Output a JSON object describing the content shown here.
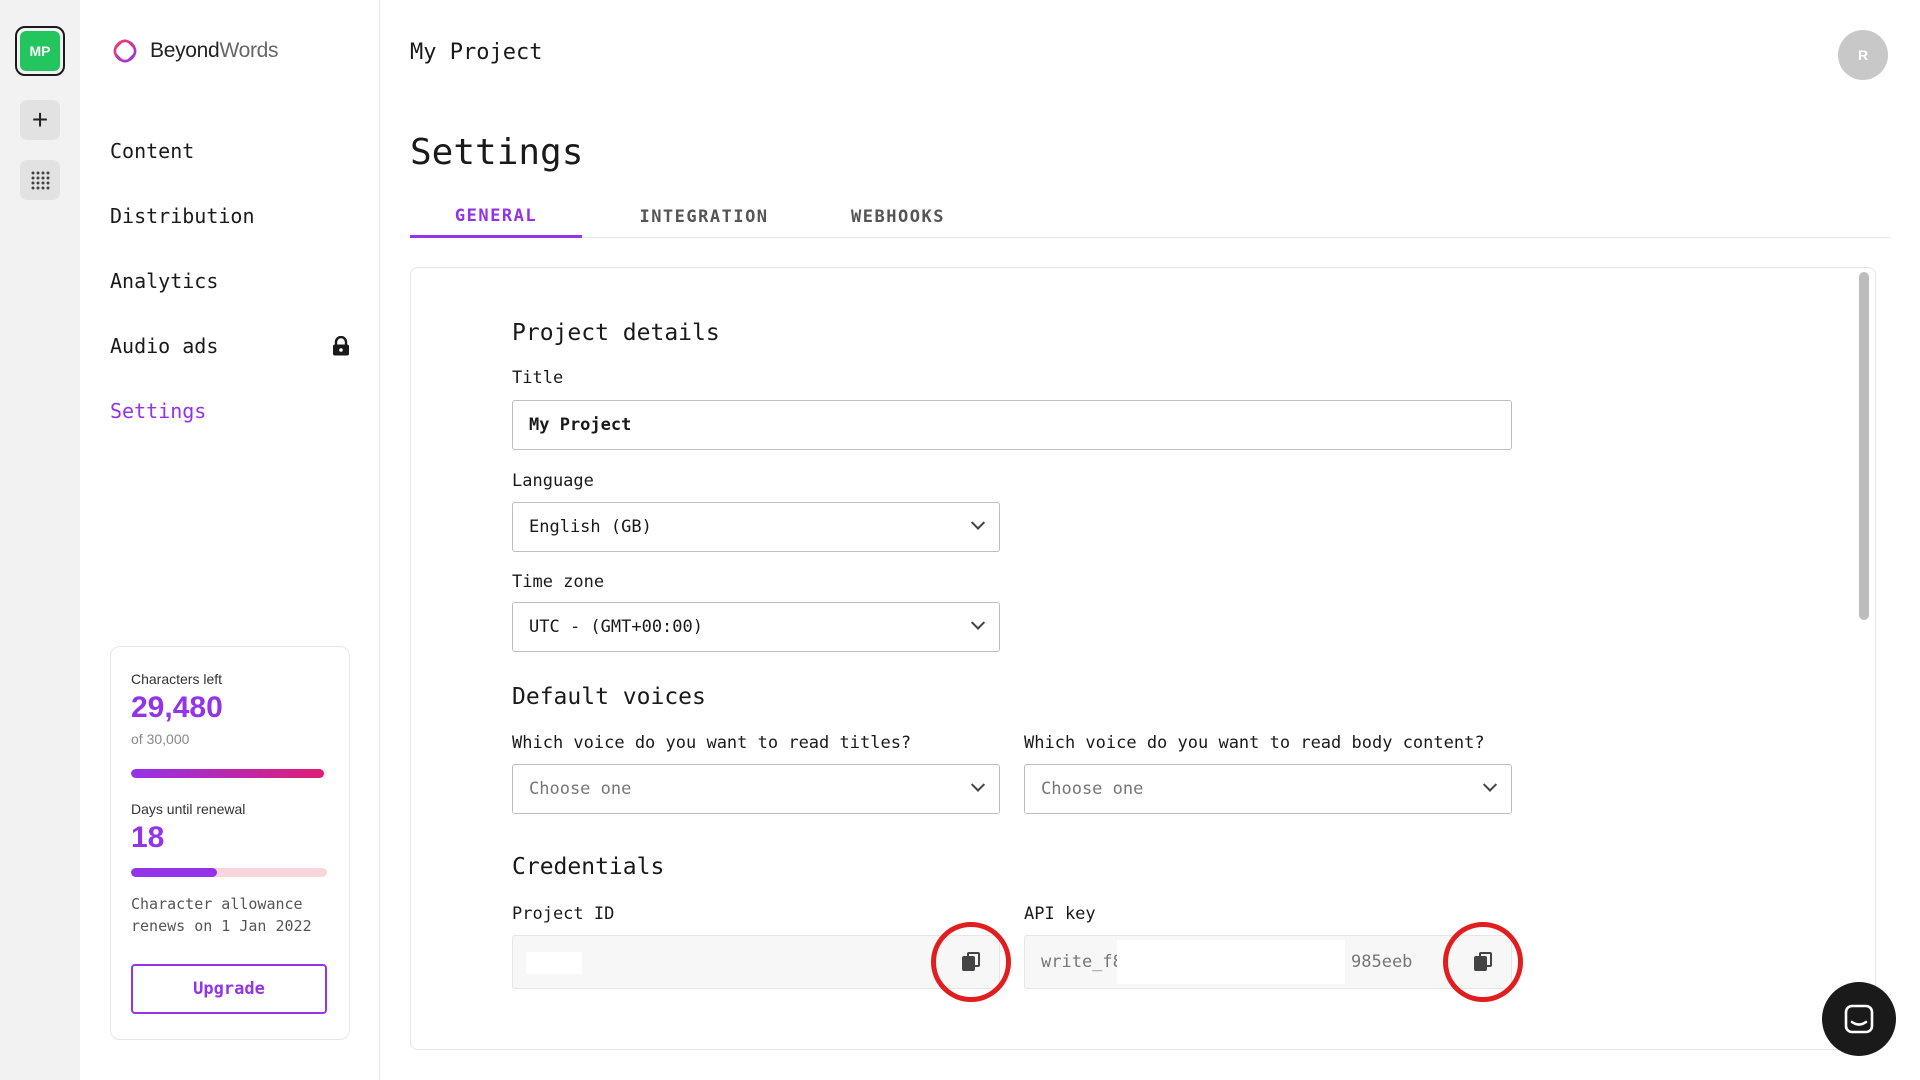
{
  "workspace": {
    "initials": "MP"
  },
  "brand": {
    "name_part1": "Beyond",
    "name_part2": "Words",
    "accent": "#9333ea"
  },
  "sidebar": {
    "items": [
      {
        "label": "Content"
      },
      {
        "label": "Distribution"
      },
      {
        "label": "Analytics"
      },
      {
        "label": "Audio ads",
        "locked": true
      },
      {
        "label": "Settings",
        "active": true
      }
    ]
  },
  "usage": {
    "chars_label": "Characters left",
    "chars_value": "29,480",
    "chars_total": "of 30,000",
    "chars_fraction": 0.983,
    "renewal_label": "Days until renewal",
    "renewal_value": "18",
    "renewal_fraction": 0.44,
    "note": "Character allowance renews on 1 Jan 2022",
    "upgrade_label": "Upgrade"
  },
  "header": {
    "project_name": "My Project",
    "user_initial": "R"
  },
  "page": {
    "title": "Settings"
  },
  "tabs": [
    {
      "label": "GENERAL",
      "active": true
    },
    {
      "label": "INTEGRATION"
    },
    {
      "label": "WEBHOOKS"
    }
  ],
  "project_details": {
    "heading": "Project details",
    "title_label": "Title",
    "title_value": "My Project",
    "language_label": "Language",
    "language_value": "English (GB)",
    "timezone_label": "Time zone",
    "timezone_value": "UTC - (GMT+00:00)"
  },
  "default_voices": {
    "heading": "Default voices",
    "title_voice_label": "Which voice do you want to read titles?",
    "title_voice_placeholder": "Choose one",
    "body_voice_label": "Which voice do you want to read body content?",
    "body_voice_placeholder": "Choose one"
  },
  "credentials": {
    "heading": "Credentials",
    "project_id_label": "Project ID",
    "project_id_value": "",
    "api_key_label": "API key",
    "api_key_prefix": "write_f8",
    "api_key_suffix": "985eeb"
  },
  "colors": {
    "progress_gradient": [
      "#9333ea",
      "#e11d74"
    ],
    "renewal_track": "#fbd5dc",
    "highlight_circle": "#e11d1d"
  }
}
